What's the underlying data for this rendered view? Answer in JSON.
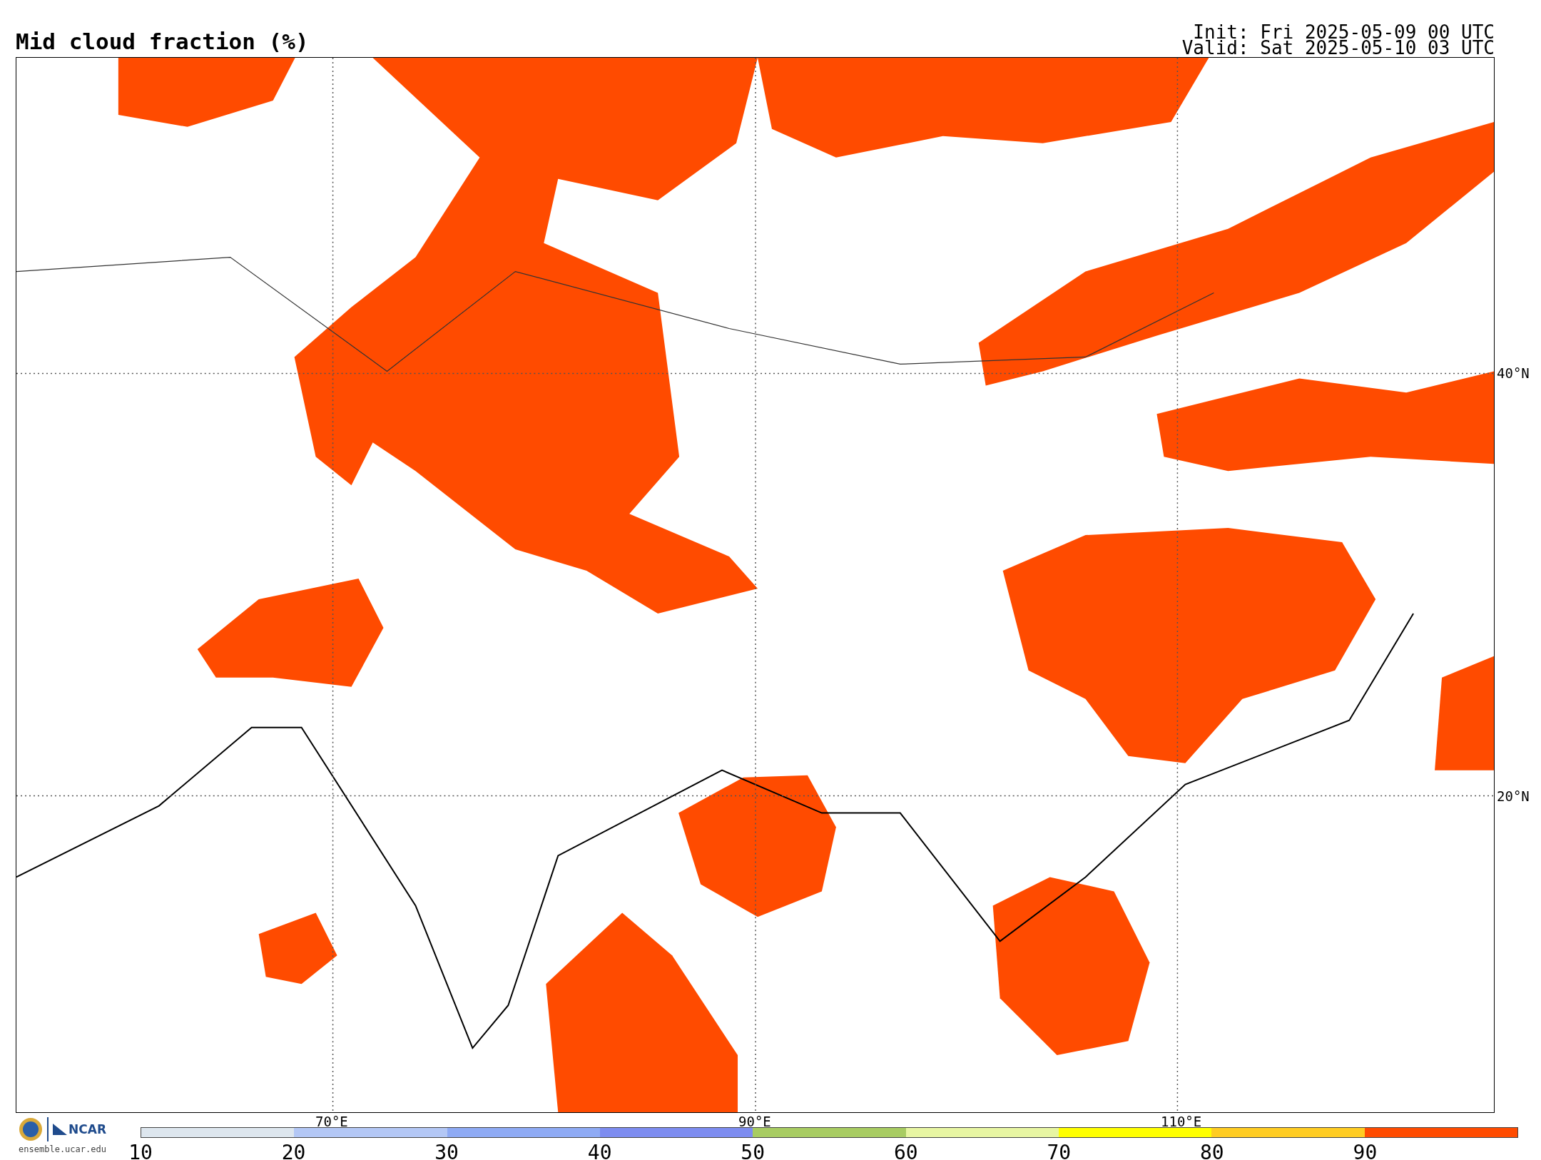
{
  "title": "Mid cloud fraction (%)",
  "run_info": [
    "Init: Fri 2025-05-09 00 UTC",
    "Valid: Sat 2025-05-10 03 UTC"
  ],
  "map": {
    "latitude_labels": [
      "40°N",
      "20°N"
    ],
    "longitude_labels": [
      "70°E",
      "90°E",
      "110°E"
    ]
  },
  "credits": {
    "logo_text": "NCAR",
    "url": "ensemble.ucar.edu"
  },
  "colorbar": {
    "ticks": [
      "10",
      "20",
      "30",
      "40",
      "50",
      "60",
      "70",
      "80",
      "90"
    ],
    "bins": [
      {
        "color": "#dde6ee"
      },
      {
        "color": "#b3c7f5"
      },
      {
        "color": "#8eaaf4"
      },
      {
        "color": "#7d8cf0"
      },
      {
        "color": "#a8cc62"
      },
      {
        "color": "#e7f5a2"
      },
      {
        "color": "#ffff00"
      },
      {
        "color": "#ffcc22"
      },
      {
        "color": "#ff4b00"
      }
    ]
  }
}
